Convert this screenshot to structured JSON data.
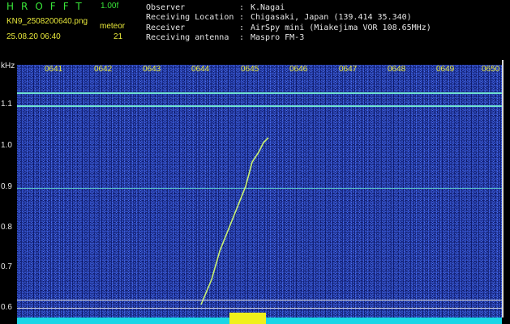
{
  "header": {
    "app_title": "HROFFT",
    "version": "1.00f",
    "filename": "KN9_2508200640.png",
    "meteor_label": "meteor",
    "timestamp": "25.08.20 06:40",
    "meteor_count": "21"
  },
  "info": [
    {
      "key": "Observer",
      "value": "K.Nagai"
    },
    {
      "key": "Receiving Location",
      "value": "Chigasaki, Japan (139.414 35.340)"
    },
    {
      "key": "Receiver",
      "value": "AirSpy mini (Miakejima VOR 108.65MHz)"
    },
    {
      "key": "Receiving antenna",
      "value": "Maspro FM-3"
    }
  ],
  "info_separator": ":",
  "plot": {
    "y_unit": "kHz",
    "y_ticks": [
      "1.1",
      "1.0",
      "0.9",
      "0.8",
      "0.7",
      "0.6"
    ],
    "x_ticks": [
      "0641",
      "0642",
      "0643",
      "0644",
      "0645",
      "0646",
      "0647",
      "0648",
      "0649",
      "0650"
    ],
    "colors": {
      "background": "#15247a",
      "carrier": "#7fe8c8",
      "meteor": "#c8f070",
      "spectrum": "#19d6e6",
      "burst": "#f0f01a"
    }
  }
}
